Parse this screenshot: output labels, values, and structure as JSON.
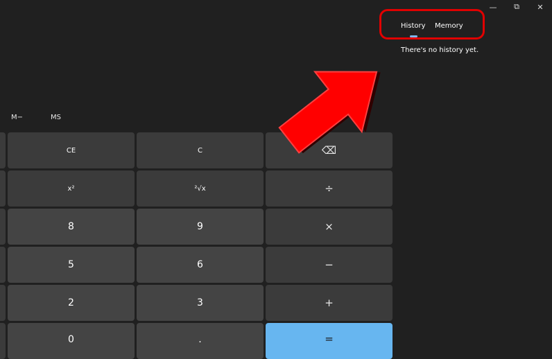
{
  "window": {
    "minimize_icon": "minimize-icon",
    "maximize_icon": "restore-icon",
    "close_icon": "close-icon",
    "minimize_glyph": "—",
    "restore_glyph": "⧉",
    "close_glyph": "✕"
  },
  "memory": {
    "m_minus": "M−",
    "ms": "MS"
  },
  "keypad": {
    "ce": "CE",
    "c": "C",
    "backspace": "⌫",
    "square": "x²",
    "sqrt": "²√x",
    "divide": "÷",
    "eight": "8",
    "nine": "9",
    "multiply": "×",
    "five": "5",
    "six": "6",
    "minus": "−",
    "two": "2",
    "three": "3",
    "plus": "+",
    "zero": "0",
    "decimal": ".",
    "equals": "="
  },
  "panel": {
    "tab_history": "History",
    "tab_memory": "Memory",
    "empty_message": "There's no history yet."
  },
  "annotation": {
    "highlight_color": "#e10000",
    "arrow_color": "#ff0000"
  },
  "colors": {
    "background": "#202020",
    "key": "#3b3b3b",
    "number_key": "#444444",
    "accent": "#67b6f0"
  }
}
